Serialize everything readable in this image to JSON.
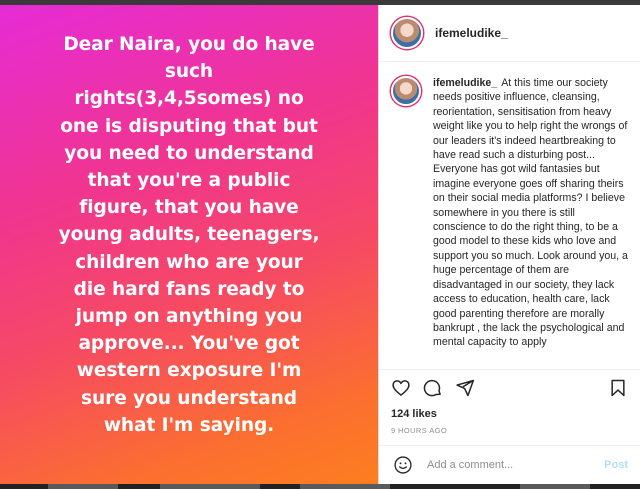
{
  "post_image": {
    "text": "Dear Naira, you do have such rights(3,4,5somes) no one is disputing that but you need to understand that you're a public figure, that you have young adults, teenagers, children who are your die hard fans ready to jump on anything you approve... You've got western exposure I'm sure you understand what I'm saying.",
    "lines": [
      "Dear Naira, you do have",
      "such",
      "rights(3,4,5somes) no",
      "one is disputing that but",
      "you need to understand",
      "that you're a public",
      "figure, that you have",
      "young adults, teenagers,",
      "children who are your",
      "die hard fans ready to",
      "jump on anything you",
      "approve... You've got",
      "western exposure I'm",
      "sure you understand",
      "what I'm saying."
    ],
    "gradient": [
      "#e62bd6",
      "#fd7e20"
    ]
  },
  "header": {
    "username": "ifemeludike_"
  },
  "comment": {
    "username": "ifemeludike_",
    "text": "At this time our society needs positive influence, cleansing, reorientation, sensitisation from heavy weight like you to help right the wrongs of our leaders it's indeed heartbreaking to have read such a disturbing post... Everyone has got wild fantasies but imagine everyone goes off sharing theirs on their social media platforms? I believe somewhere in you there is still conscience to do the right thing, to be a good model to these kids who love and support you so much. Look around you, a huge percentage of them are disadvantaged in our society, they lack access to education, health care, lack good parenting therefore are morally bankrupt , the lack the psychological and mental capacity to apply"
  },
  "actions": {
    "like_icon": "heart-icon",
    "comment_icon": "comment-icon",
    "share_icon": "share-icon",
    "save_icon": "bookmark-icon"
  },
  "likes": "124 likes",
  "timestamp": "9 HOURS AGO",
  "add_comment": {
    "placeholder": "Add a comment...",
    "post_label": "Post",
    "emoji_icon": "smiley-icon"
  }
}
